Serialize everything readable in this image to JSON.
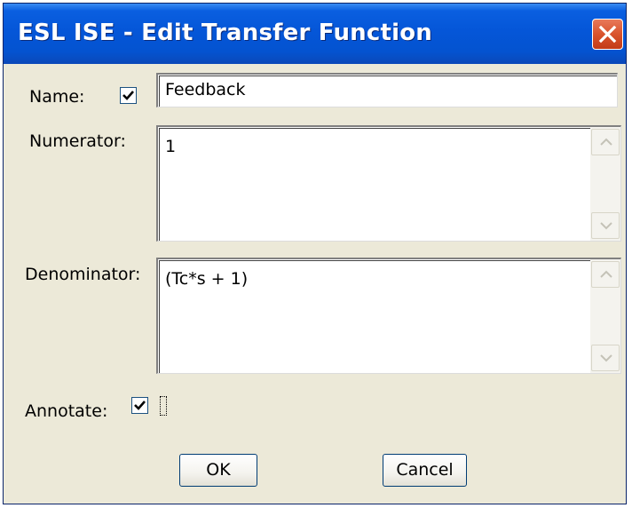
{
  "window": {
    "title": "ESL ISE - Edit Transfer Function"
  },
  "form": {
    "name_label": "Name:",
    "name_checked": true,
    "name_value": "Feedback",
    "numerator_label": "Numerator:",
    "numerator_value": "1",
    "denominator_label": "Denominator:",
    "denominator_value": "(Tc*s + 1)",
    "annotate_label": "Annotate:",
    "annotate_checked": true
  },
  "buttons": {
    "ok_label": "OK",
    "cancel_label": "Cancel"
  },
  "icons": {
    "close": "close-icon",
    "check": "checkmark-icon",
    "scroll_up": "chevron-up-icon",
    "scroll_down": "chevron-down-icon"
  },
  "colors": {
    "titlebar": "#0556d8",
    "dialog_bg": "#ece9d8",
    "close_button": "#d9532d"
  }
}
